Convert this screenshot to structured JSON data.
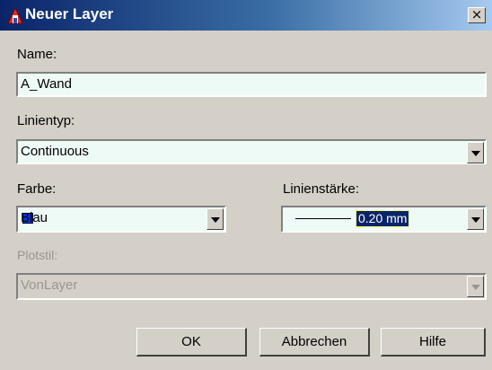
{
  "window": {
    "title": "Neuer Layer",
    "close_label": "×"
  },
  "name": {
    "label": "Name:",
    "value": "A_Wand"
  },
  "linetype": {
    "label": "Linientyp:",
    "value": "Continuous"
  },
  "color": {
    "label": "Farbe:",
    "value": "Blau",
    "swatch_color": "#0033ff"
  },
  "lineweight": {
    "label": "Linienstärke:",
    "value": "0.20 mm"
  },
  "plotstyle": {
    "label": "Plotstil:",
    "value": "VonLayer",
    "disabled": true
  },
  "buttons": {
    "ok": "OK",
    "cancel": "Abbrechen",
    "help": "Hilfe"
  }
}
